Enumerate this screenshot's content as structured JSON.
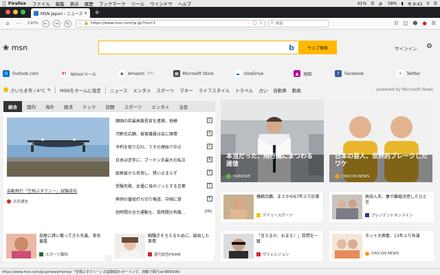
{
  "menubar": {
    "app_name": "Firefox",
    "items": [
      "ファイル",
      "編集",
      "表示",
      "履歴",
      "ブックマーク",
      "ツール",
      "ウインドウ",
      "ヘルプ"
    ],
    "battery": "61%",
    "battery2": "58%",
    "clock": "木 9:43"
  },
  "tab": {
    "title": "MSN Japan - ニュース, 天気, メ"
  },
  "navbar": {
    "zoom": "110%",
    "url": "https://www.msn.com/ja-jp/?ins=1",
    "search_placeholder": "検索"
  },
  "header": {
    "logo": "msn",
    "search_button": "ウェブ検索",
    "signin": "サインイン"
  },
  "quicklinks": [
    {
      "label": "Outlook.com",
      "icon": "outlook-icon",
      "color": "#0072c6"
    },
    {
      "label": "Yahoo!メール",
      "icon": "yahoo-icon",
      "color": "#ff0033"
    },
    {
      "label": "Amazon",
      "sublabel": "[PR]",
      "icon": "amazon-icon",
      "color": "#222222"
    },
    {
      "label": "Microsoft Store",
      "icon": "store-icon",
      "color": "#444444"
    },
    {
      "label": "OneDrive",
      "icon": "onedrive-icon",
      "color": "#0364b8"
    },
    {
      "label": "地図",
      "icon": "map-icon",
      "color": "#b4009e"
    },
    {
      "label": "Facebook",
      "icon": "facebook-icon",
      "color": "#3b5998"
    },
    {
      "label": "Twitter",
      "icon": "twitter-icon",
      "color": "#1da1f2"
    }
  ],
  "weather": {
    "location": "さいたま市 / 6°C"
  },
  "set_home": "MSNをホームに設定",
  "categories": [
    "ニュース",
    "エンタメ",
    "スポーツ",
    "マネー",
    "ライフスタイル",
    "トラベル",
    "占い",
    "自動車",
    "動画"
  ],
  "powered_by": "powered by Microsoft News",
  "feed": {
    "tabs": [
      "総合",
      "国内",
      "海外",
      "経済",
      "テック",
      "話題",
      "スポーツ",
      "エンタメ",
      "注目"
    ],
    "active_tab": 0,
    "hero_caption": "自動飛行「空飛ぶタクシー」試験成功",
    "hero_source": "共同通信",
    "headlines": [
      {
        "text": "韓国の前最高裁長官を逮捕、地検",
        "src": "C"
      },
      {
        "text": "河野氏応酬、被害議員は会に陳情",
        "src": "S"
      },
      {
        "text": "予約を取り忘れ、うその理由で中止",
        "src": "C"
      },
      {
        "text": "日本は逆手に、プーチン氏最大の拡点",
        "src": "B"
      },
      {
        "text": "総務省から名指し、賢い止まらず",
        "src": "Y"
      },
      {
        "text": "受験失敗、女優に母のゾッとする言葉",
        "src": "T"
      },
      {
        "text": "興例の番組打ち切り報道、中国に寧",
        "src": "F"
      },
      {
        "text": "短時間の全力運動も、長時間の有酸…",
        "src": "[PR]"
      }
    ]
  },
  "card1": {
    "caption": "本当だった、飛行機にまつわる迷信",
    "source": "TABIZINE"
  },
  "card2": {
    "caption": "日本の芸人、世界的ブレークしたワケ",
    "source": "ORICON NEWS"
  },
  "small_cards": [
    {
      "text": "横綱白鵬、まさかの67年ぶり珍事",
      "source": "デイリースポーツ"
    },
    {
      "text": "高収入夫、妻が離婚決意したひと言",
      "source": "プレジデントオンライン"
    }
  ],
  "bottom_cards": [
    {
      "text": "部屋に誘い襲ってきた先輩、実名暴露",
      "source": "スポーツ報知"
    },
    {
      "text": "胸騒ぎそろえるために、破局した事情",
      "source": "週刊女性PRIME"
    },
    {
      "text": "「言えるか、おまえ！」質問を一蹴",
      "source": "ザテレビジョン"
    },
    {
      "text": "ネット大興奮、13年ぶり共演",
      "source": "ORICON NEWS"
    }
  ],
  "statusbar": "https://www.msn.com/ja-jp/news/money/「空飛ぶタクシー」の試験成功-ボーイング、自動で飛行/ar-BBStkWs"
}
